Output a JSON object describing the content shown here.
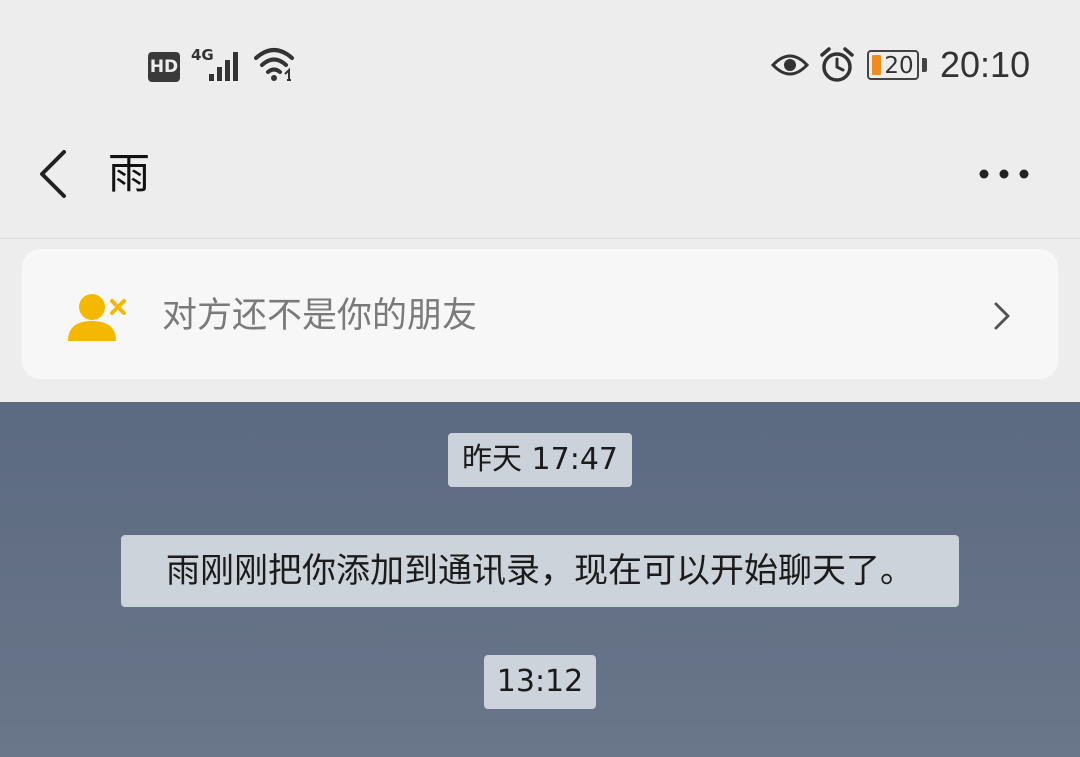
{
  "status_bar": {
    "hd_label": "HD",
    "network_label": "4G",
    "battery_level": "20",
    "time": "20:10"
  },
  "header": {
    "title": "雨"
  },
  "banner": {
    "text": "对方还不是你的朋友"
  },
  "chat": {
    "messages": [
      {
        "type": "timestamp",
        "text": "昨天 17:47"
      },
      {
        "type": "system",
        "text": "雨刚刚把你添加到通讯录，现在可以开始聊天了。"
      },
      {
        "type": "timestamp",
        "text": "13:12"
      }
    ]
  },
  "colors": {
    "battery_fill": "#f08c1a",
    "banner_icon": "#f5b800",
    "chat_background": "#5c6a82"
  },
  "icons": {
    "back": "back-chevron-icon",
    "more": "more-dots-icon",
    "banner": "user-remove-icon",
    "banner_arrow": "chevron-right-icon"
  }
}
